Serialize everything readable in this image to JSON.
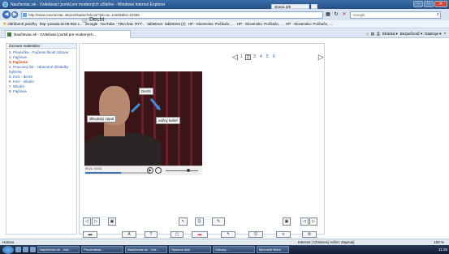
{
  "window": {
    "title": "Naučteviac.sk - Vzdelávací portál pre moderných učiteľov - Windows Internet Explorer",
    "buttons": {
      "minimize": "–",
      "maximize": "□",
      "close": "✕"
    }
  },
  "address_bar": {
    "url": "http://www.naucteviac.sk/prehliadac/lekcia/?lekcia=11658&lid=10465",
    "search_placeholder": "Google"
  },
  "favorites_bar": {
    "items": [
      "Obľúbené položky",
      "http--pravda.sk-08-052-c...",
      "iGoogle",
      "YouTube - TINA feat. RYT...",
      "tabletreet",
      "tabletreet (2)",
      "HP - Slovensko: Počítače, ...",
      "HP - Slovensko: Počítače, ...",
      "HP - Slovensko: Počítače, ..."
    ]
  },
  "tab_bar": {
    "active_tab": "Naučteviac.sk - Vzdelávací portál pre moderných...",
    "commands": [
      "Stránka ▾",
      "Bezpečnosť ▾",
      "Nástroje ▾"
    ]
  },
  "sidebar": {
    "header": "Zoznam materiálov",
    "items": [
      {
        "label": "1. Písanička - Fajčenie škodí zdraviu",
        "active": false
      },
      {
        "label": "2. Fajčenie",
        "active": false
      },
      {
        "label": "3. Fajčenie",
        "active": true
      },
      {
        "label": "4. Pracovný list - zdravotné dôsledky fajčenia",
        "active": false
      },
      {
        "label": "5. Kvíz - dechť",
        "active": false
      },
      {
        "label": "6. Kvíz - nikotín",
        "active": false
      },
      {
        "label": "7. Nikotín",
        "active": false
      },
      {
        "label": "8. Fajčenie",
        "active": false
      }
    ]
  },
  "main": {
    "page_indicator": "strana 2/9",
    "slide_title": "Decht",
    "pager": {
      "prev": "◁",
      "next": "▷",
      "pages": [
        "1",
        "2",
        "3",
        "4",
        "5",
        "6"
      ],
      "active_page": "2"
    },
    "video": {
      "callouts": {
        "top": "Decht",
        "left": "dlhodobý zápal",
        "right": "vážny kašeľ"
      },
      "time": "00:21 / 00:31",
      "play_symbol": "▶",
      "progress_fraction": 0.55,
      "volume_fraction": 0.7
    }
  },
  "bottom_toolbar": {
    "row1": [
      "◁",
      "▷",
      "▣",
      "↖",
      "Q",
      "✎",
      "▣",
      "◁",
      "▷"
    ],
    "row2": [
      "▬",
      "A",
      "T",
      "▢",
      "▬",
      "↰",
      "Ω",
      "≡",
      "⚙"
    ]
  },
  "status": {
    "left": "Hotovo",
    "internet": "Internet | Chránený režim: Zapnutý",
    "zoom": "100 %"
  },
  "taskbar": {
    "tasks": [
      "Naučteviac.sk - Vzd...",
      "Prezentácia...",
      "Naučteviac.sk - Vzd...",
      "Správca úloh",
      "Odkazy...",
      "Microsoft Word"
    ],
    "clock": "11:25"
  },
  "colors": {
    "active_sidebar_item": "#c2410c",
    "link_blue": "#2a58a6",
    "title_bar": "#2b5a94"
  }
}
